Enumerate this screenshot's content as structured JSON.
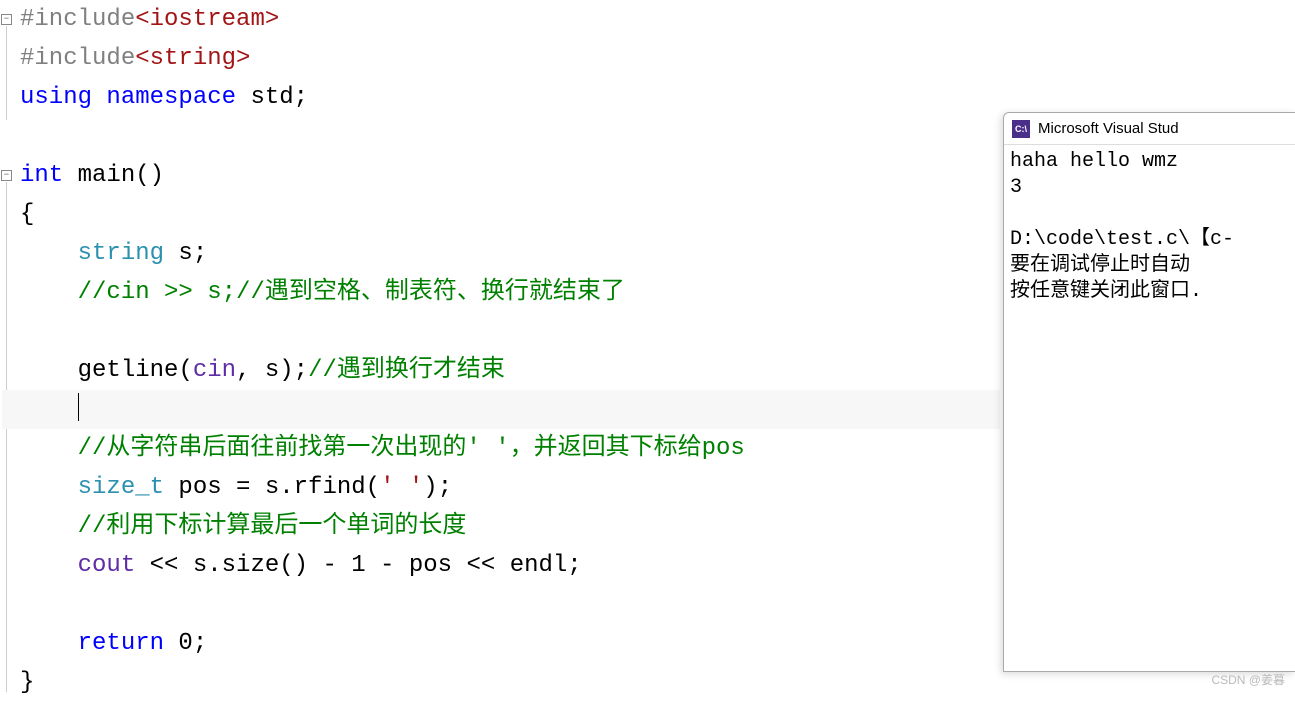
{
  "code": {
    "line1_pre": "#include",
    "line1_hdr": "<iostream>",
    "line2_pre": "#include",
    "line2_hdr": "<string>",
    "line3_using": "using",
    "line3_ns": "namespace",
    "line3_std": "std",
    "line5_int": "int",
    "line5_main": "main()",
    "line8_string": "string",
    "line8_s": " s;",
    "line9_com1": "//cin >> s;//遇到空格、制表符、换行就结束了",
    "line11_getline": "getline",
    "line11_args_pre": "(",
    "line11_cin": "cin",
    "line11_args_post": ", s);",
    "line11_com": "//遇到换行才结束",
    "line13_com": "//从字符串后面往前找第一次出现的' '，并返回其下标给pos",
    "line14_sizet": "size_t",
    "line14_rest": " pos = s.rfind(",
    "line14_chr": "' '",
    "line14_end": ");",
    "line15_com": "//利用下标计算最后一个单词的长度",
    "line16_cout": "cout",
    "line16_mid": " << s.size() - 1 - pos << ",
    "line16_endl": "endl",
    "line16_end": ";",
    "line18_ret": "return",
    "line18_val": " 0;"
  },
  "console": {
    "title": "Microsoft Visual Stud",
    "out1": "haha hello wmz",
    "out2": "3",
    "out3": "",
    "out4": "D:\\code\\test.c\\【c-",
    "out5": "要在调试停止时自动",
    "out6": "按任意键关闭此窗口."
  },
  "watermark": "CSDN @姜暮"
}
